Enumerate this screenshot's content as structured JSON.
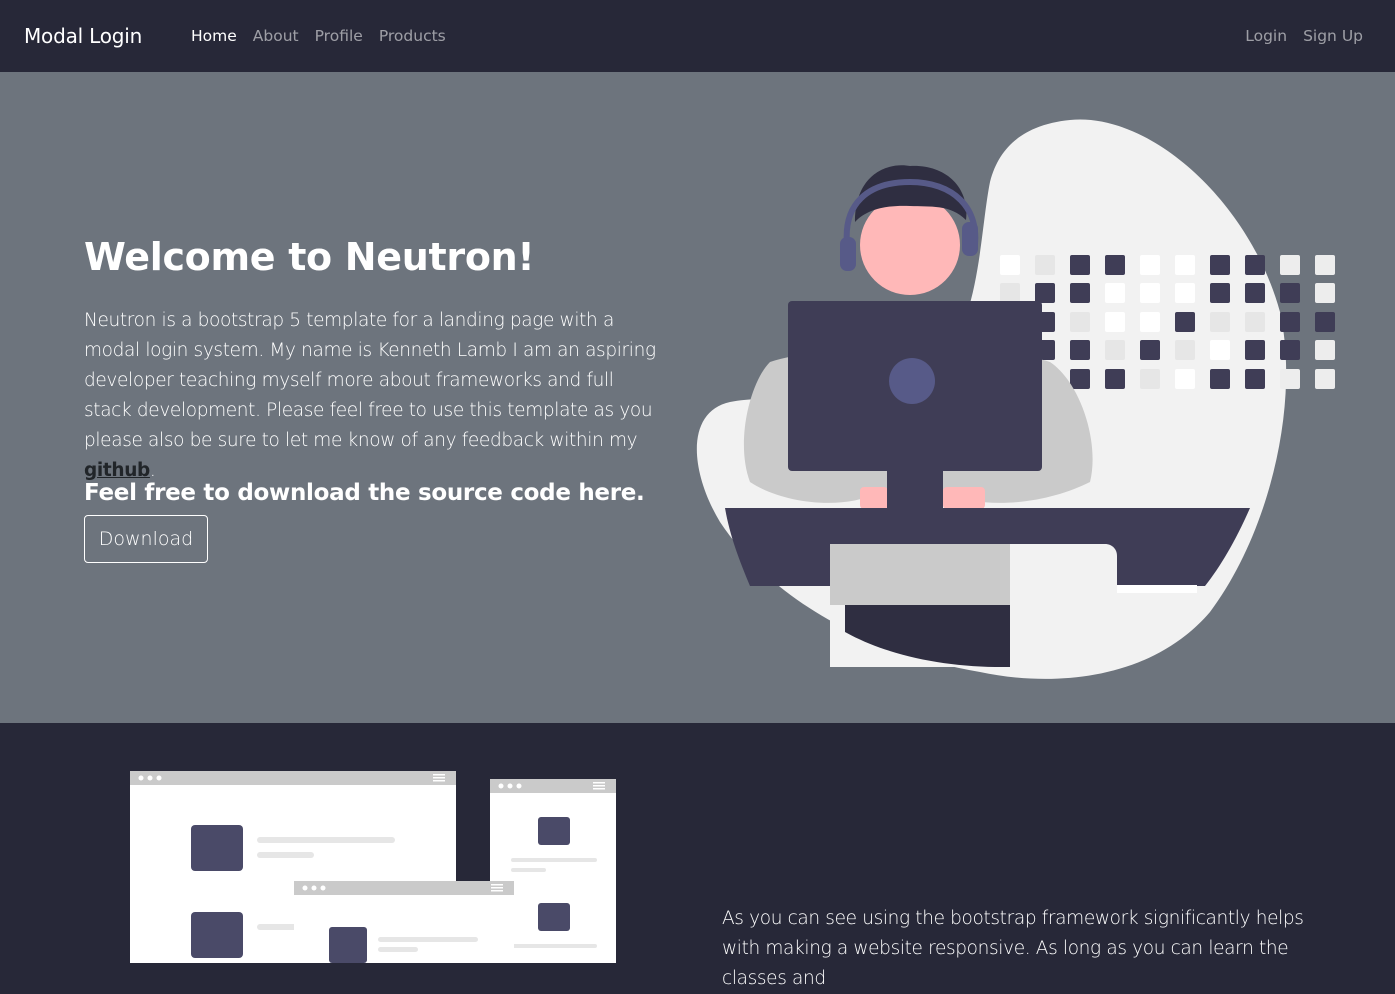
{
  "navbar": {
    "brand": "Modal Login",
    "links": [
      {
        "label": "Home",
        "active": true
      },
      {
        "label": "About",
        "active": false
      },
      {
        "label": "Profile",
        "active": false
      },
      {
        "label": "Products",
        "active": false
      }
    ],
    "auth": {
      "login": "Login",
      "signup": "Sign Up"
    }
  },
  "hero": {
    "title": "Welcome to Neutron!",
    "description": "Neutron is a bootstrap 5 template for a landing page with a modal login system. My name is Kenneth Lamb I am an aspiring developer teaching myself more about frameworks and full stack development. Please feel free to use this template as you please also be sure to let me know of any feedback within my ",
    "link_text": "github",
    "description_end": ".",
    "subheading": "Feel free to download the source code here.",
    "download_label": "Download"
  },
  "section2": {
    "text": "As you can see using the bootstrap framework significantly helps with making a website responsive. As long as you can learn the classes and"
  },
  "colors": {
    "nav_bg": "#272838",
    "hero_bg": "#6d747d",
    "accent_dark": "#3f3d56",
    "illustration_light": "#f2f2f2"
  }
}
